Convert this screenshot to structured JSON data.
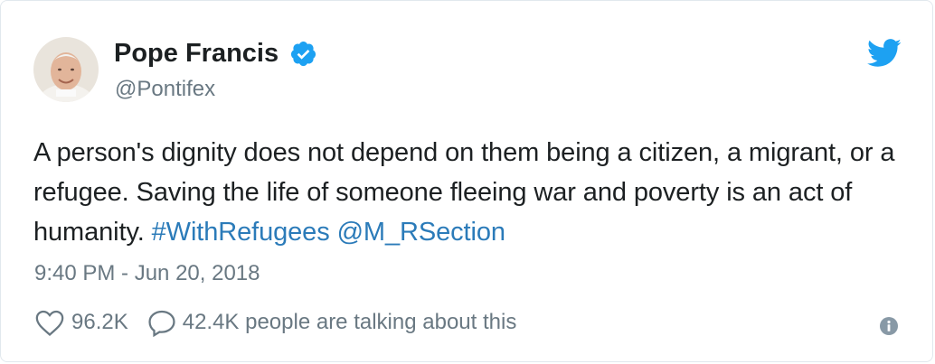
{
  "author": {
    "name": "Pope Francis",
    "handle": "@Pontifex",
    "verified": true
  },
  "tweet": {
    "text": "A person's dignity does not depend on them being a citizen, a migrant, or a refugee. Saving the life of someone fleeing war and poverty is an act of humanity. ",
    "hashtag": "#WithRefugees",
    "mention": "@M_RSection",
    "timestamp": "9:40 PM - Jun 20, 2018"
  },
  "actions": {
    "likes": "96.2K",
    "talking": "42.4K people are talking about this"
  },
  "icons": {
    "brand": "twitter-bird-icon",
    "verified": "verified-badge-icon",
    "like": "heart-icon",
    "reply": "speech-bubble-icon",
    "info": "info-icon"
  },
  "colors": {
    "brand": "#1da1f2",
    "link": "#2b7bb9",
    "muted": "#697882",
    "text": "#1c2022"
  }
}
